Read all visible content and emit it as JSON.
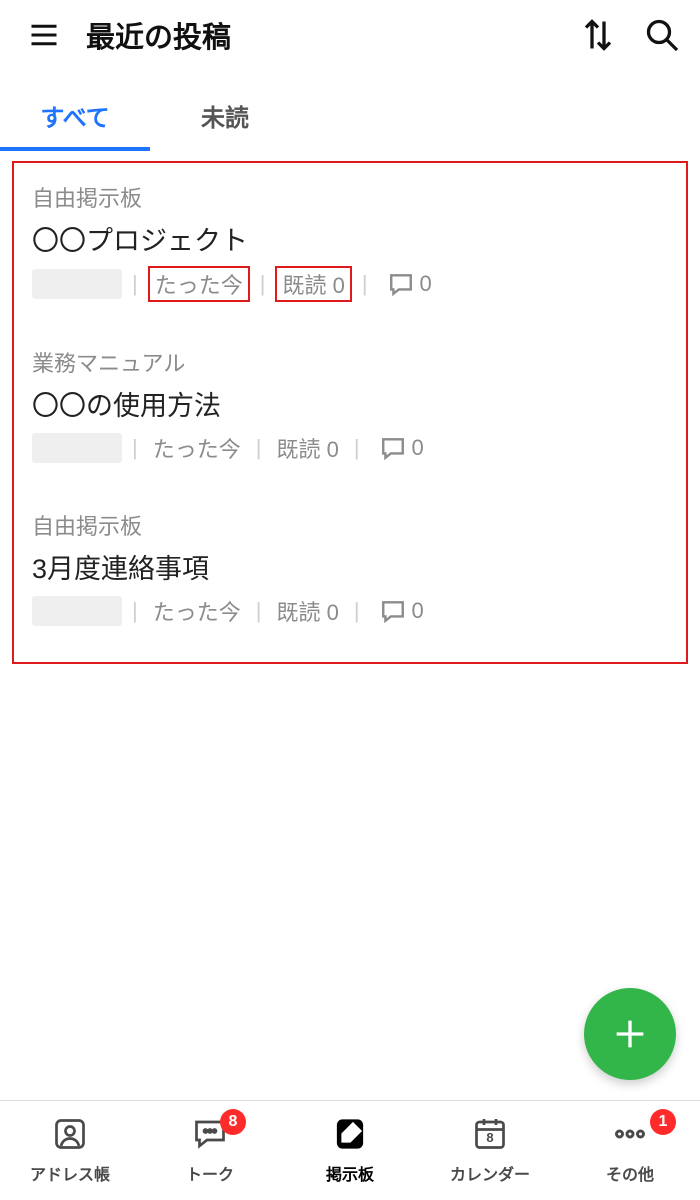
{
  "header": {
    "title": "最近の投稿"
  },
  "tabs": {
    "all": "すべて",
    "unread": "未読"
  },
  "posts": [
    {
      "category": "自由掲示板",
      "title": "〇〇プロジェクト",
      "time": "たった今",
      "read_label": "既読 0",
      "comments": "0",
      "highlight": true
    },
    {
      "category": "業務マニュアル",
      "title": "〇〇の使用方法",
      "time": "たった今",
      "read_label": "既読 0",
      "comments": "0",
      "highlight": false
    },
    {
      "category": "自由掲示板",
      "title": "3月度連絡事項",
      "time": "たった今",
      "read_label": "既読 0",
      "comments": "0",
      "highlight": false
    }
  ],
  "nav": {
    "contacts": "アドレス帳",
    "talk": "トーク",
    "board": "掲示板",
    "calendar": "カレンダー",
    "calendar_day": "8",
    "more": "その他",
    "talk_badge": "8",
    "more_badge": "1"
  }
}
